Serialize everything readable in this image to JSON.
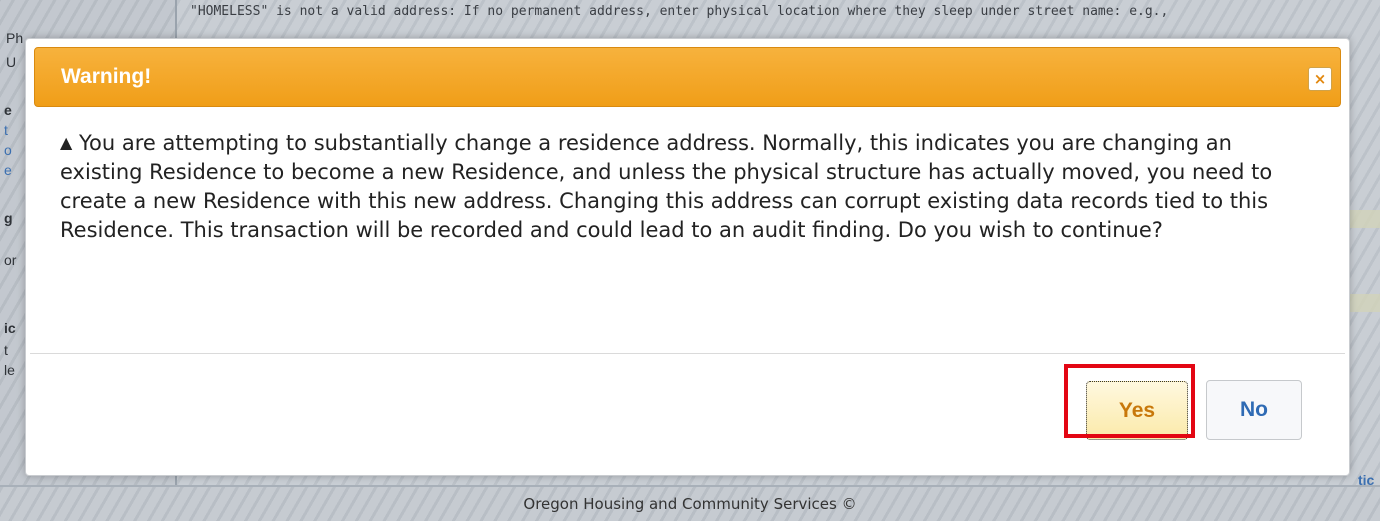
{
  "background": {
    "notice": "\"HOMELESS\" is not a valid address: If no permanent address, enter physical location where they sleep under street name: e.g.,",
    "footer": "Oregon Housing and Community Services ©",
    "side_fragments": [
      "Ph",
      "U",
      "e",
      "t",
      "o",
      "e",
      "g",
      "or",
      "ic",
      "t",
      "le"
    ],
    "right_fragment": "tic"
  },
  "dialog": {
    "title": "Warning!",
    "close_glyph": "×",
    "warning_glyph": "▲",
    "message": "You are attempting to substantially change a residence address. Normally, this indicates you are changing an existing Residence to become a new Residence, and unless the physical structure has actually moved, you need to create a new Residence with this new address. Changing this address can corrupt existing data records tied to this Residence. This transaction will be recorded and could lead to an audit finding. Do you wish to continue?",
    "yes_label": "Yes",
    "no_label": "No"
  },
  "colors": {
    "titlebar": "#f0a020",
    "yes_text": "#c8780b",
    "no_text": "#2f6bb4",
    "highlight": "#e30613"
  }
}
